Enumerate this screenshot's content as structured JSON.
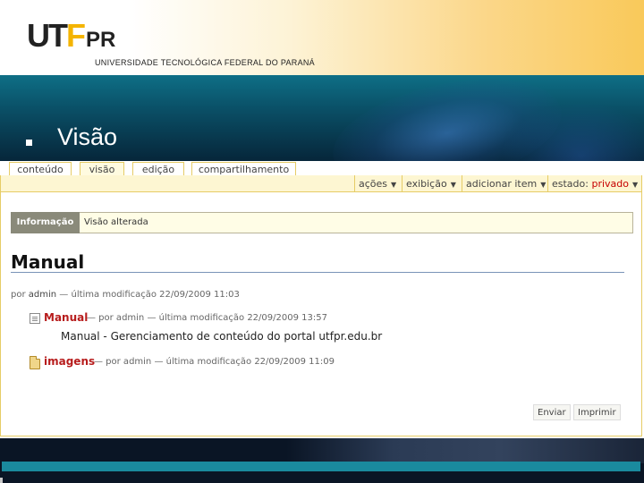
{
  "header": {
    "logo_main": "UT",
    "logo_accent": "F",
    "logo_suffix": "PR",
    "university": "UNIVERSIDADE TECNOLÓGICA FEDERAL DO PARANÁ"
  },
  "slide": {
    "title": "Visão"
  },
  "tabs": [
    {
      "label": "conteúdo",
      "active": false
    },
    {
      "label": "visão",
      "active": true
    },
    {
      "label": "edição",
      "active": false
    },
    {
      "label": "compartilhamento",
      "active": false
    }
  ],
  "actions": {
    "acoes": "ações",
    "exibicao": "exibição",
    "adicionar": "adicionar item",
    "estado_label": "estado:",
    "estado_value": "privado",
    "arrow": "▼"
  },
  "info": {
    "label": "Informação",
    "message": "Visão alterada"
  },
  "document": {
    "title": "Manual",
    "byline_prefix": "por",
    "author": "admin",
    "byline_suffix": "— última modificação 22/09/2009 11:03"
  },
  "items": [
    {
      "icon": "page-icon",
      "name": "Manual",
      "meta": "— por admin — última modificação 22/09/2009 13:57",
      "description": "Manual - Gerenciamento de conteúdo do portal utfpr.edu.br"
    },
    {
      "icon": "folder-icon",
      "name": "imagens",
      "meta": "— por admin — última modificação 22/09/2009 11:09"
    }
  ],
  "buttons": {
    "send": "Enviar",
    "print": "Imprimir"
  },
  "colors": {
    "accent_yellow": "#f4b400",
    "link_red": "#b71c1c",
    "teal": "#1a8a9e"
  }
}
